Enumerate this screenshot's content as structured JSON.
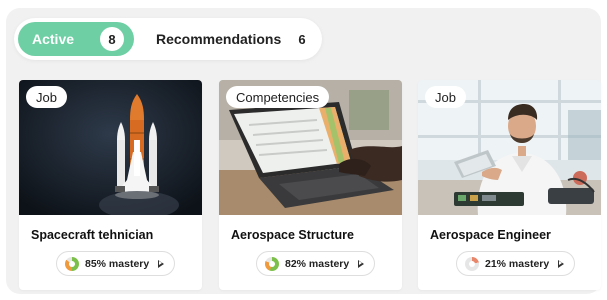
{
  "tabs": [
    {
      "label": "Active",
      "count": "8"
    },
    {
      "label": "Recommendations",
      "count": "6"
    }
  ],
  "cards": [
    {
      "badge": "Job",
      "title": "Spacecraft tehnician",
      "mastery": "85% mastery",
      "mastery_percent": 85,
      "icon": "rocket-launch-image"
    },
    {
      "badge": "Competencies",
      "title": "Aerospace Structure",
      "mastery": "82% mastery",
      "mastery_percent": 82,
      "icon": "laptop-image"
    },
    {
      "badge": "Job",
      "title": "Aerospace Engineer",
      "mastery": "21% mastery",
      "mastery_percent": 21,
      "icon": "engineer-image"
    }
  ],
  "colors": {
    "accent": "#6ecfa4",
    "donut_high": "#7cc04b",
    "donut_mid": "#f09a3e",
    "donut_low": "#e7866a"
  }
}
